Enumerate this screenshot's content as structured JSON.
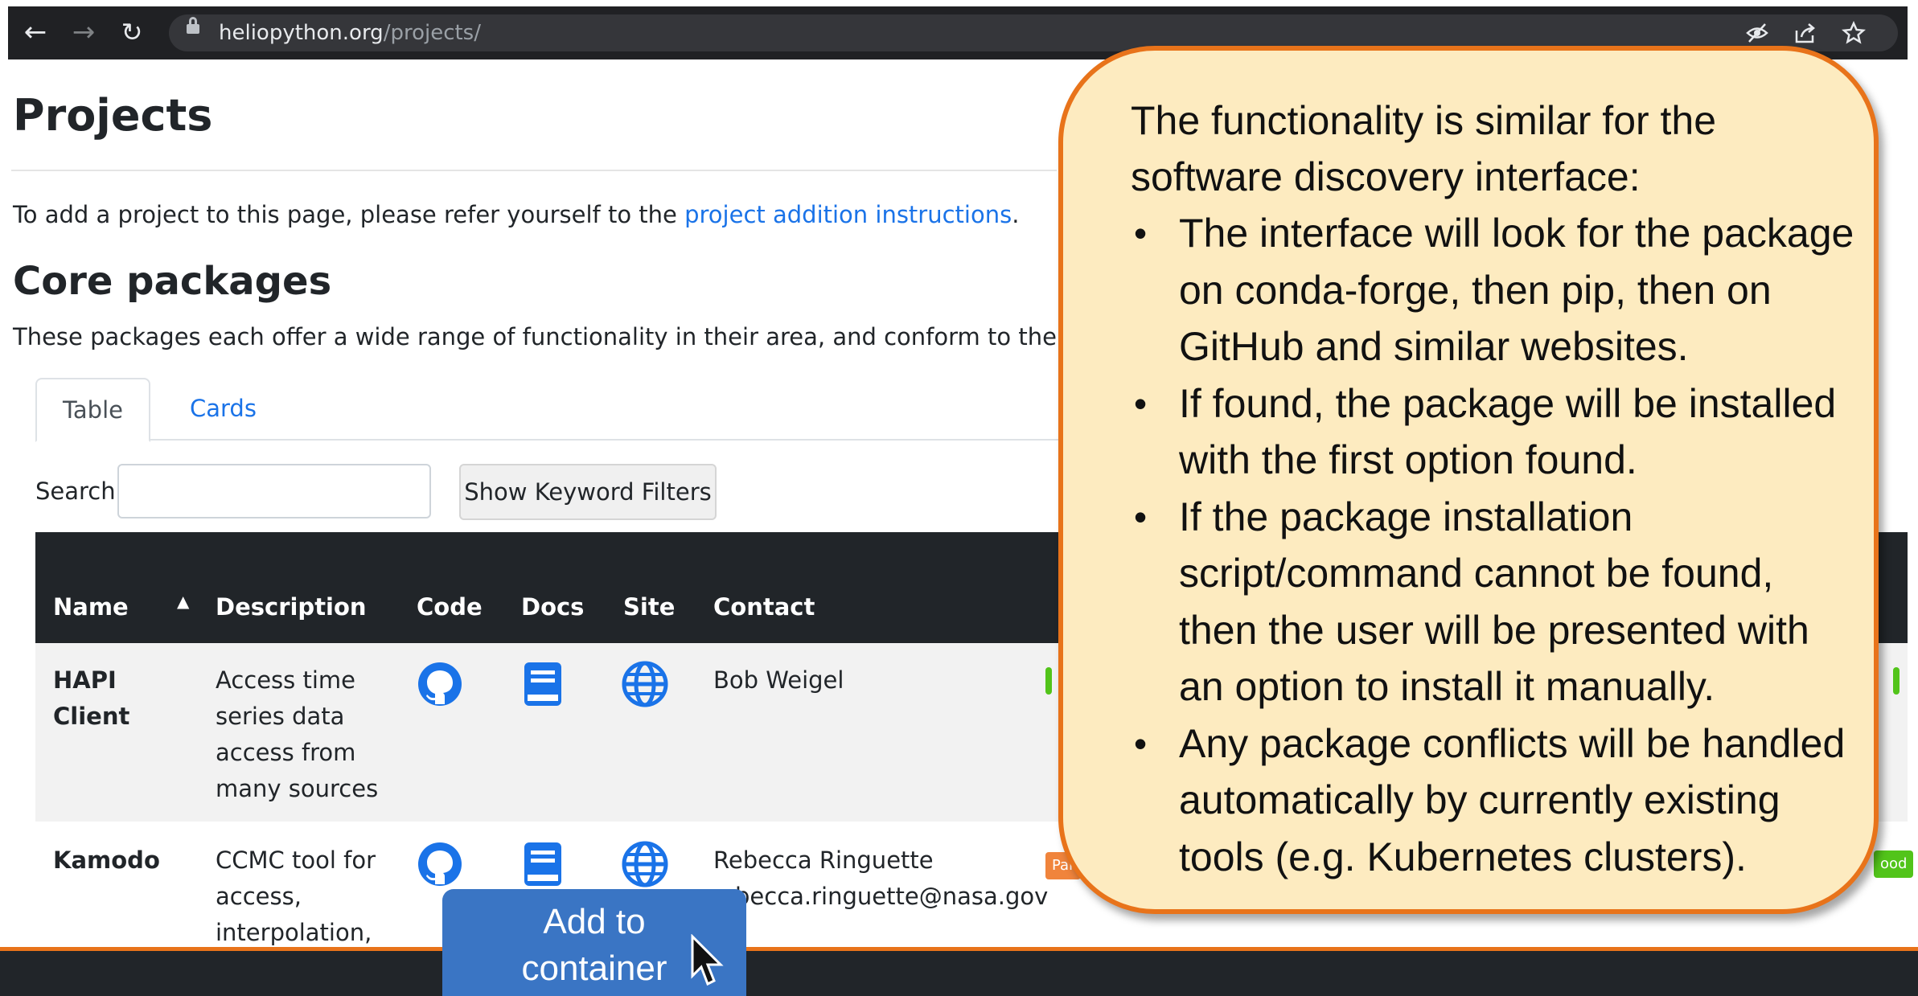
{
  "browser": {
    "url_domain": "heliopython.org",
    "url_path": "/projects/"
  },
  "page": {
    "title": "Projects",
    "intro_text": "To add a project to this page, please refer yourself to the ",
    "intro_link": "project addition instructions",
    "intro_end": ".",
    "section_title": "Core packages",
    "section_desc": "These packages each offer a wide range of functionality in their area, and conform to the PyHC com"
  },
  "tabs": [
    {
      "label": "Table"
    },
    {
      "label": "Cards"
    }
  ],
  "search": {
    "label": "Search:",
    "value": "",
    "keyword_button": "Show Keyword Filters"
  },
  "table": {
    "headers": [
      "Name",
      "Description",
      "Code",
      "Docs",
      "Site",
      "Contact"
    ],
    "rows": [
      {
        "name_line1": "HAPI",
        "name_line2": "Client",
        "desc": [
          "Access time",
          "series data",
          "access from",
          "many sources"
        ],
        "contact_line1": "Bob Weigel",
        "contact_line2": ""
      },
      {
        "name_line1": "Kamodo",
        "name_line2": "",
        "desc": [
          "CCMC tool for",
          "access,",
          "interpolation,"
        ],
        "contact_line1": "Rebecca Ringuette",
        "contact_line2": "becca.ringuette@nasa.gov"
      }
    ],
    "badges": [
      "Par",
      "ood"
    ]
  },
  "overlay": {
    "add_button_line1": "Add to",
    "add_button_line2": "container",
    "callout_lead": "The functionality is similar for the software discovery interface:",
    "callout_items": [
      "The interface will look for the package on conda-forge, then pip, then on GitHub and similar websites.",
      "If found, the package will be installed with the first option found.",
      "If the package installation script/command cannot be found, then the user will be presented with an option to install it manually.",
      "Any package conflicts will be handled automatically by currently existing tools (e.g. Kubernetes clusters)."
    ]
  },
  "colors": {
    "link": "#1a73e8",
    "callout_bg": "#fdebc0",
    "callout_border": "#e8731a",
    "button_blue": "#3a75c4",
    "badge_green": "#52c41a",
    "badge_orange": "#f0843c"
  },
  "icons": [
    "back-arrow-icon",
    "forward-arrow-icon",
    "reload-icon",
    "lock-icon",
    "eye-off-icon",
    "share-icon",
    "star-icon",
    "github-icon",
    "docs-book-icon",
    "globe-icon",
    "cursor-arrow-icon"
  ]
}
